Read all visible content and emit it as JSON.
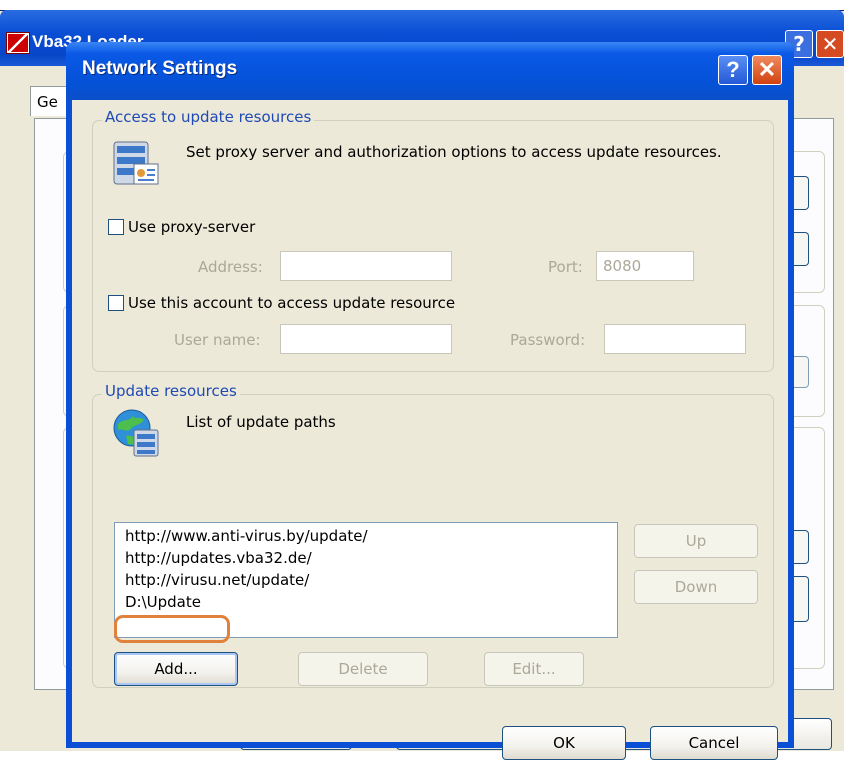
{
  "background_window": {
    "title": "Vba32 Loader",
    "tab_label": "Ge",
    "help_glyph": "?",
    "close_glyph": "✕"
  },
  "dialog": {
    "title": "Network Settings",
    "help_glyph": "?",
    "close_glyph": "✕"
  },
  "access_group": {
    "legend": "Access to update resources",
    "description": "Set proxy server and authorization options to access update resources.",
    "use_proxy_label": "Use proxy-server",
    "use_proxy_checked": false,
    "address_label": "Address:",
    "address_value": "",
    "port_label": "Port:",
    "port_value": "8080",
    "use_account_label": "Use this account to access update resource",
    "use_account_checked": false,
    "username_label": "User name:",
    "username_value": "",
    "password_label": "Password:",
    "password_value": ""
  },
  "update_group": {
    "legend": "Update resources",
    "description": "List of update paths",
    "paths": [
      "http://www.anti-virus.by/update/",
      "http://updates.vba32.de/",
      "http://virusu.net/update/",
      "D:\\Update"
    ],
    "up_label": "Up",
    "down_label": "Down",
    "add_label": "Add...",
    "delete_label": "Delete",
    "edit_label": "Edit..."
  },
  "footer": {
    "ok_label": "OK",
    "cancel_label": "Cancel"
  },
  "colors": {
    "title_bar": "#0a4fd6",
    "dialog_face": "#ece9d8",
    "group_legend": "#1f49b5",
    "highlight_ring": "#e0823c",
    "disabled_text": "#aca899"
  }
}
